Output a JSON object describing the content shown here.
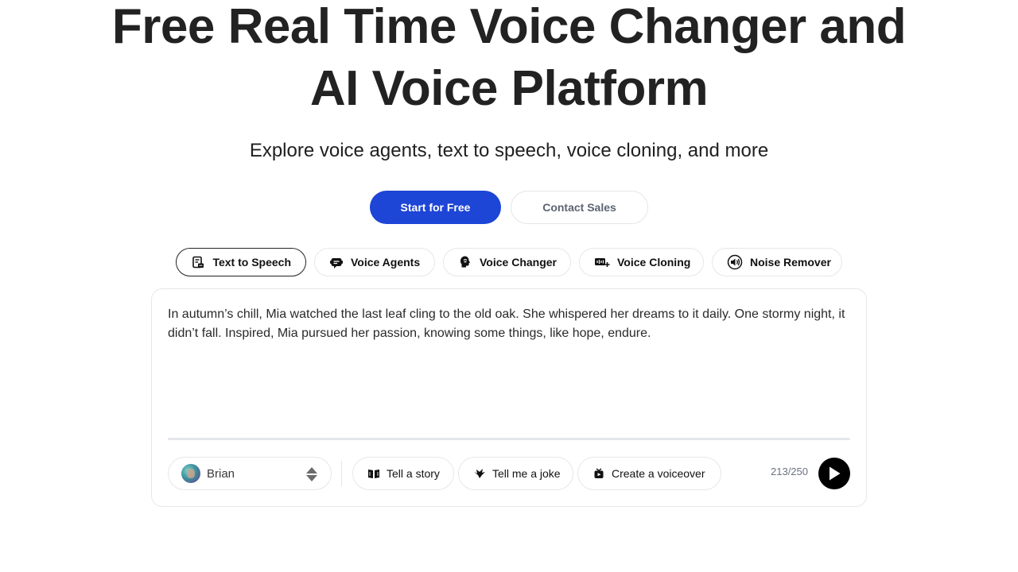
{
  "hero": {
    "title_line1": "Free Real Time Voice Changer and",
    "title_line2": "AI Voice Platform",
    "subtitle": "Explore voice agents, text to speech, voice cloning, and more"
  },
  "cta": {
    "primary": "Start for Free",
    "secondary": "Contact Sales"
  },
  "tabs": [
    {
      "label": "Text to Speech",
      "icon": "text-to-speech-icon",
      "active": true
    },
    {
      "label": "Voice Agents",
      "icon": "voice-agents-icon",
      "active": false
    },
    {
      "label": "Voice Changer",
      "icon": "voice-changer-icon",
      "active": false
    },
    {
      "label": "Voice Cloning",
      "icon": "voice-cloning-icon",
      "active": false
    },
    {
      "label": "Noise Remover",
      "icon": "noise-remover-icon",
      "active": false
    }
  ],
  "editor": {
    "text": "In autumn’s chill, Mia watched the last leaf cling to the old oak. She whispered her dreams to it daily. One stormy night, it didn’t fall. Inspired, Mia pursued her passion, knowing some things, like hope, endure.",
    "voice": {
      "name": "Brian",
      "avatar": "avatar"
    },
    "chips": [
      {
        "label": "Tell a story",
        "icon": "book-icon"
      },
      {
        "label": "Tell me a joke",
        "icon": "joke-icon"
      },
      {
        "label": "Create a voiceover",
        "icon": "voiceover-icon"
      }
    ],
    "char_count": "213/250",
    "play_icon": "play-icon"
  },
  "colors": {
    "primary": "#1d45d6",
    "text": "#222222",
    "muted": "#6b7280",
    "border": "#e6e7ea"
  }
}
